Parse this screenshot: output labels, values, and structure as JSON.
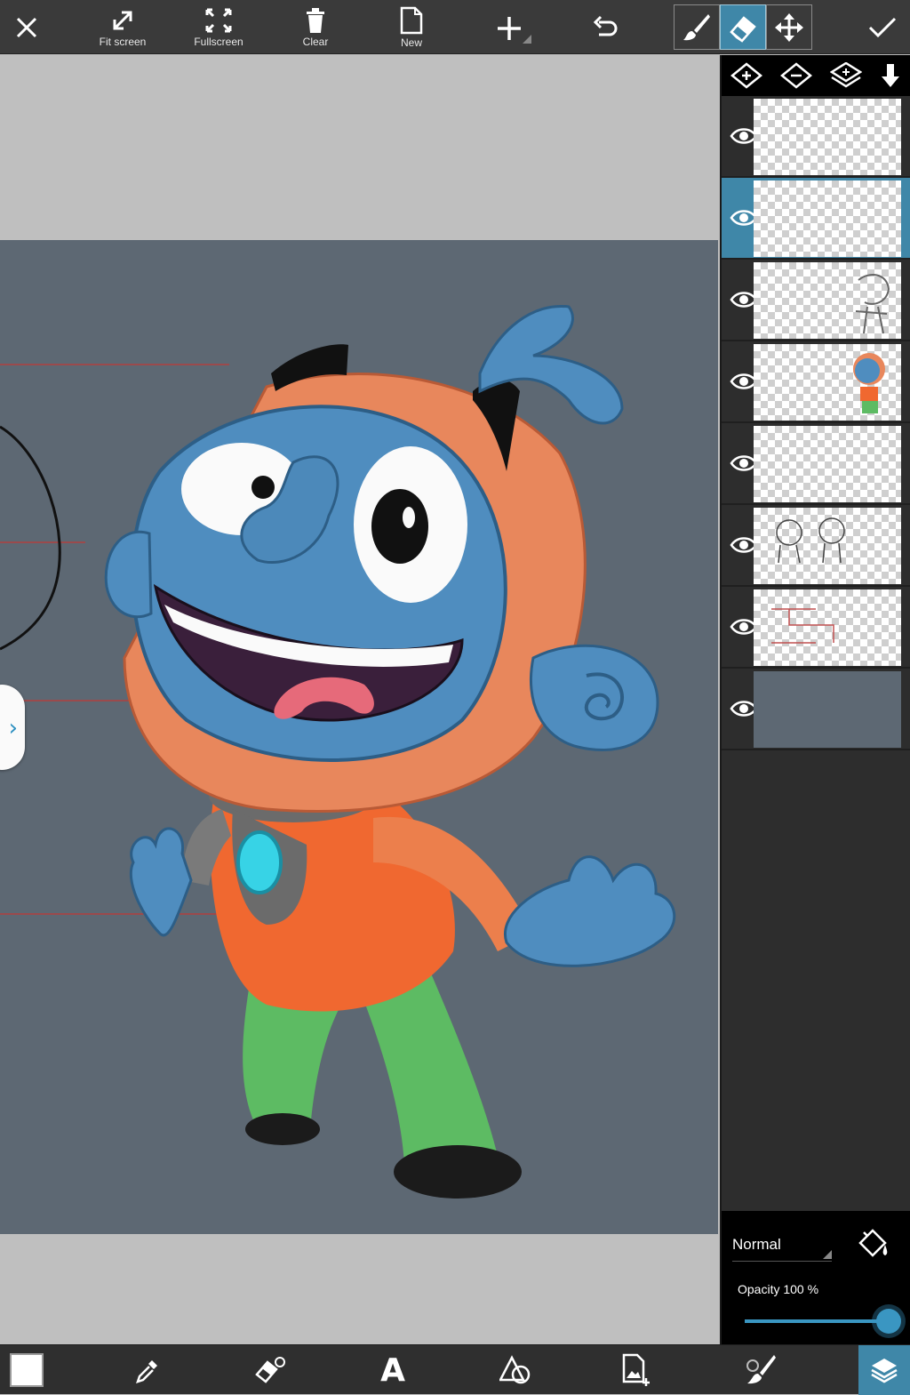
{
  "toolbar": {
    "fit_screen_label": "Fit screen",
    "fullscreen_label": "Fullscreen",
    "clear_label": "Clear",
    "new_label": "New"
  },
  "layers_panel": {
    "blend_mode": "Normal",
    "opacity_label": "Opacity  100 %",
    "opacity_value": 1.0,
    "selected_layer_index": 1,
    "layer_count": 8
  },
  "icons": {
    "close": "close-icon",
    "fit_screen": "fit-screen-icon",
    "fullscreen": "fullscreen-icon",
    "clear": "trash-icon",
    "new": "document-icon",
    "add": "plus-icon",
    "undo": "undo-icon",
    "brush": "brush-icon",
    "eraser": "eraser-icon",
    "move": "move-icon",
    "confirm": "check-icon",
    "text_tool_glyph": "A"
  },
  "colors": {
    "accent": "#3f87a8",
    "canvas_background": "#5d6873",
    "current_color": "#ffffff"
  }
}
